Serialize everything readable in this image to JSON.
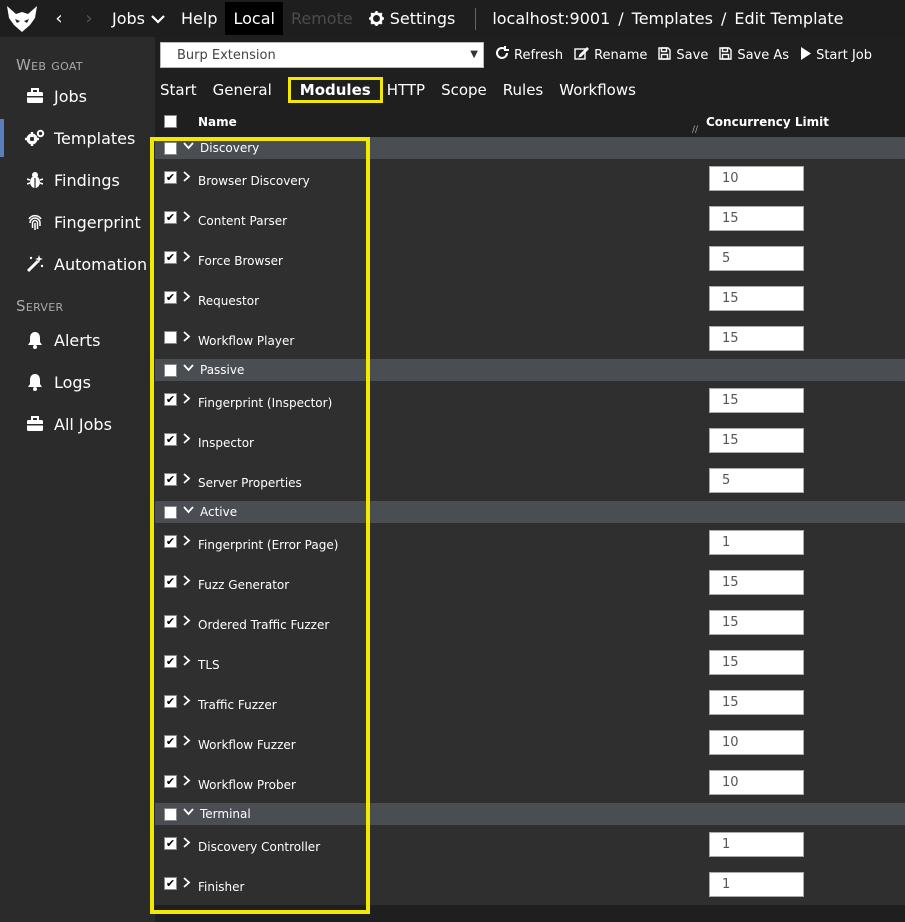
{
  "top": {
    "nav": [
      "Jobs",
      "Help",
      "Local",
      "Remote",
      "Settings"
    ],
    "crumbs": [
      "localhost:9001",
      "/",
      "Templates",
      "/",
      "Edit Template"
    ]
  },
  "sidebar": {
    "heading_webgoat": "Web goat",
    "heading_server": "Server",
    "items": [
      {
        "label": "Jobs",
        "icon": "briefcase-icon"
      },
      {
        "label": "Templates",
        "icon": "gears-icon"
      },
      {
        "label": "Findings",
        "icon": "bug-icon"
      },
      {
        "label": "Fingerprint",
        "icon": "fingerprint-icon"
      },
      {
        "label": "Automation",
        "icon": "magic-wand-icon"
      },
      {
        "label": "Alerts",
        "icon": "bell-icon"
      },
      {
        "label": "Logs",
        "icon": "bell-icon"
      },
      {
        "label": "All Jobs",
        "icon": "briefcase-icon"
      }
    ]
  },
  "toolbar": {
    "template_select": "Burp Extension",
    "refresh": "Refresh",
    "rename": "Rename",
    "save": "Save",
    "save_as": "Save As",
    "start_job": "Start Job"
  },
  "tabs": [
    "Start",
    "General",
    "Modules",
    "HTTP",
    "Scope",
    "Rules",
    "Workflows"
  ],
  "grid": {
    "col_name": "Name",
    "col_concurrency": "Concurrency Limit",
    "groups": [
      {
        "label": "Discovery",
        "modules": [
          {
            "name": "Browser Discovery",
            "limit": "10"
          },
          {
            "name": "Content Parser",
            "limit": "15"
          },
          {
            "name": "Force Browser",
            "limit": "5"
          },
          {
            "name": "Requestor",
            "limit": "15"
          },
          {
            "name": "Workflow Player",
            "limit": "15",
            "unchecked": true
          }
        ]
      },
      {
        "label": "Passive",
        "modules": [
          {
            "name": "Fingerprint (Inspector)",
            "limit": "15"
          },
          {
            "name": "Inspector",
            "limit": "15"
          },
          {
            "name": "Server Properties",
            "limit": "5"
          }
        ]
      },
      {
        "label": "Active",
        "modules": [
          {
            "name": "Fingerprint (Error Page)",
            "limit": "1"
          },
          {
            "name": "Fuzz Generator",
            "limit": "15"
          },
          {
            "name": "Ordered Traffic Fuzzer",
            "limit": "15"
          },
          {
            "name": "TLS",
            "limit": "15"
          },
          {
            "name": "Traffic Fuzzer",
            "limit": "15"
          },
          {
            "name": "Workflow Fuzzer",
            "limit": "10"
          },
          {
            "name": "Workflow Prober",
            "limit": "10"
          }
        ]
      },
      {
        "label": "Terminal",
        "modules": [
          {
            "name": "Discovery Controller",
            "limit": "1"
          },
          {
            "name": "Finisher",
            "limit": "1"
          }
        ]
      }
    ]
  },
  "colors": {
    "highlight": "#f2e900",
    "group_row": "#4a4d52",
    "accent": "#5a7fbf"
  }
}
